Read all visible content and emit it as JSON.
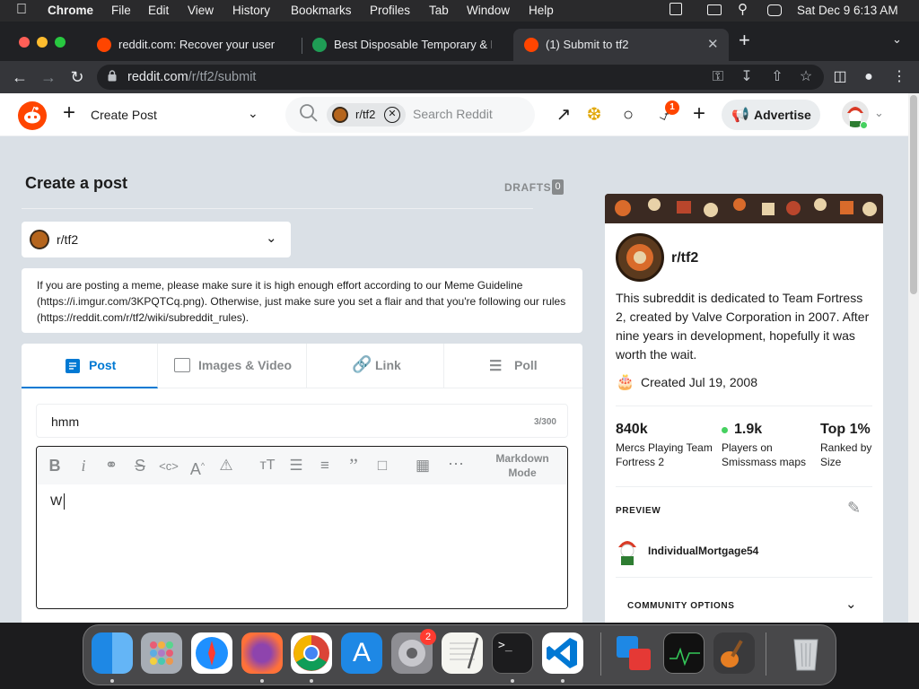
{
  "menubar": {
    "app": "Chrome",
    "items": [
      "File",
      "Edit",
      "View",
      "History",
      "Bookmarks",
      "Profiles",
      "Tab",
      "Window",
      "Help"
    ],
    "clock": "Sat Dec 9  6:13 AM"
  },
  "tabs": [
    {
      "title": "reddit.com: Recover your usern"
    },
    {
      "title": "Best Disposable Temporary & F"
    },
    {
      "title": "(1) Submit to tf2"
    }
  ],
  "address": {
    "host": "reddit.com",
    "path": "/r/tf2/submit"
  },
  "header": {
    "create_post": "Create Post",
    "search_chip": "r/tf2",
    "search_placeholder": "Search Reddit",
    "notif_count": "1",
    "advertise": "Advertise"
  },
  "form": {
    "heading": "Create a post",
    "drafts_label": "DRAFTS",
    "drafts_count": "0",
    "community": "r/tf2",
    "notice": "If you are posting a meme, please make sure it is high enough effort according to our Meme Guideline (https://i.imgur.com/3KPQTCq.png). Otherwise, just make sure you set a flair and that you're following our rules (https://reddit.com/r/tf2/wiki/subreddit_rules).",
    "tabs": [
      "Post",
      "Images & Video",
      "Link",
      "Poll"
    ],
    "title_value": "hmm",
    "title_count": "3/300",
    "markdown_mode": "Markdown Mode",
    "body_value": "W"
  },
  "sidebar": {
    "name": "r/tf2",
    "description": "This subreddit is dedicated to Team Fortress 2, created by Valve Corporation in 2007. After nine years in development, hopefully it was worth the wait.",
    "created": "Created Jul 19, 2008",
    "stats": [
      {
        "value": "840k",
        "label": "Mercs Playing Team Fortress 2"
      },
      {
        "value": "1.9k",
        "label": "Players on Smissmass maps"
      },
      {
        "value": "Top 1%",
        "label": "Ranked by Size"
      }
    ],
    "preview_label": "PREVIEW",
    "preview_user": "IndividualMortgage54",
    "community_options": "COMMUNITY OPTIONS"
  },
  "dock": {
    "settings_badge": "2"
  },
  "colors": {
    "brand": "#ff4500",
    "accent": "#0079d3",
    "online": "#46d160"
  }
}
